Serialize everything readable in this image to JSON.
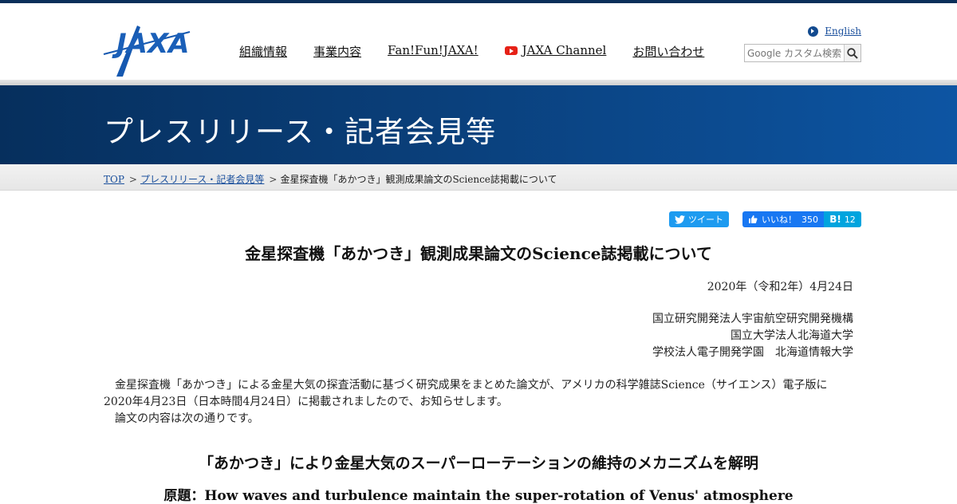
{
  "header": {
    "logo_text": "JAXA",
    "nav": [
      "組織情報",
      "事業内容",
      "Fan!Fun!JAXA!",
      "JAXA Channel",
      "お問い合わせ"
    ],
    "english_link": "English",
    "search_placeholder": "Google カスタム検索"
  },
  "banner": {
    "title": "プレスリリース・記者会見等"
  },
  "breadcrumb": {
    "top": "TOP",
    "sep": ">",
    "section": "プレスリリース・記者会見等",
    "current": "金星探査機「あかつき」観測成果論文のScience誌掲載について"
  },
  "social": {
    "tweet": "ツイート",
    "like": "いいね！",
    "like_count": "350",
    "hatena": "B!",
    "hatena_count": "12"
  },
  "article": {
    "title": "金星探査機「あかつき」観測成果論文のScience誌掲載について",
    "date": "2020年（令和2年）4月24日",
    "orgs": [
      "国立研究開発法人宇宙航空研究開発機構",
      "国立大学法人北海道大学",
      "学校法人電子開発学園　北海道情報大学"
    ],
    "paragraphs": [
      "金星探査機「あかつき」による金星大気の探査活動に基づく研究成果をまとめた論文が、アメリカの科学雑誌Science（サイエンス）電子版に2020年4月23日（日本時間4月24日）に掲載されましたので、お知らせします。",
      "論文の内容は次の通りです。"
    ],
    "subtitle": "「あかつき」により金星大気のスーパーローテーションの維持のメカニズムを解明",
    "original_title": "原題：How waves and turbulence maintain the super-rotation of Venus' atmosphere"
  },
  "colors": {
    "banner": "#0a3f7a",
    "link": "#1a4f9c",
    "twitter": "#1d9bf0",
    "facebook": "#1877f2",
    "hatena": "#00a4de"
  }
}
